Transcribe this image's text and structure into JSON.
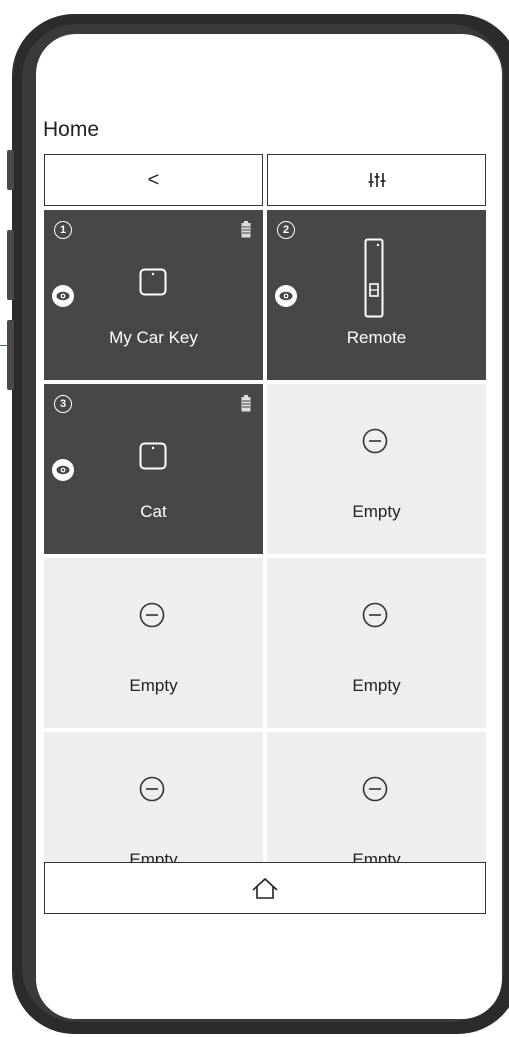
{
  "header": {
    "title": "Home"
  },
  "toolbar": {
    "back_label": "<",
    "settings_icon": "sliders-icon"
  },
  "tiles": [
    {
      "number": "1",
      "label": "My Car Key",
      "state": "active",
      "device": "tag",
      "battery": true
    },
    {
      "number": "2",
      "label": "Remote",
      "state": "active",
      "device": "remote",
      "battery": false
    },
    {
      "number": "3",
      "label": "Cat",
      "state": "active",
      "device": "tag",
      "battery": true
    },
    {
      "number": "",
      "label": "Empty",
      "state": "empty"
    },
    {
      "number": "",
      "label": "Empty",
      "state": "empty"
    },
    {
      "number": "",
      "label": "Empty",
      "state": "empty"
    },
    {
      "number": "",
      "label": "Empty",
      "state": "empty"
    },
    {
      "number": "",
      "label": "Empty",
      "state": "empty"
    }
  ],
  "nav": {
    "home_icon": "home-icon"
  },
  "colors": {
    "tile_dark": "#474747",
    "tile_empty": "#eeeeee",
    "callout_line": "#3d6aa8"
  }
}
